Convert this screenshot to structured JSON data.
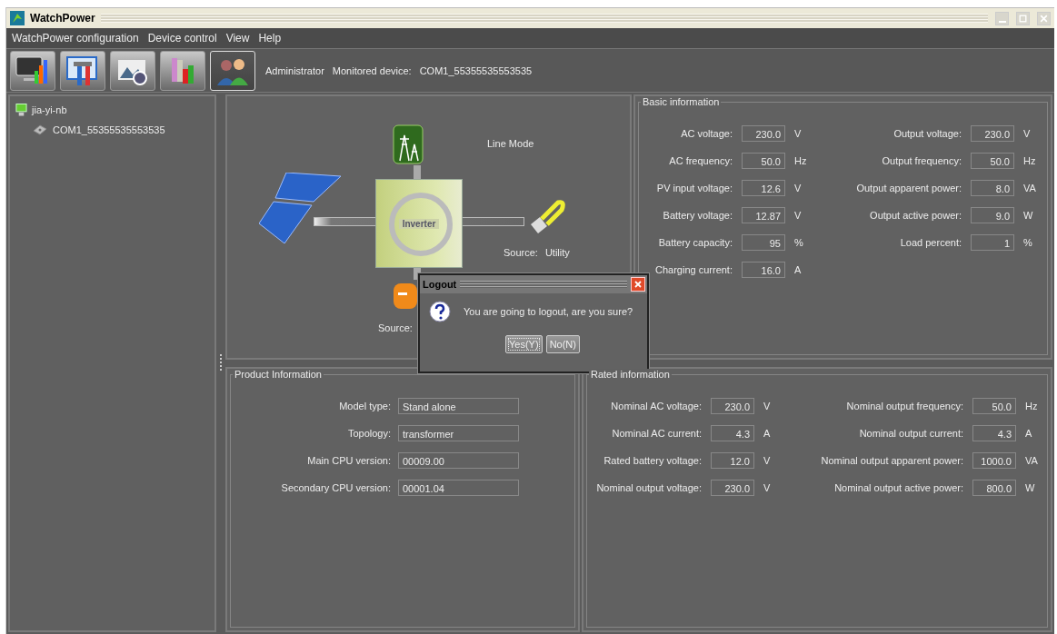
{
  "window": {
    "title": "WatchPower"
  },
  "menu": [
    "WatchPower configuration",
    "Device control",
    "View",
    "Help"
  ],
  "toolbar": {
    "buttons": [
      {
        "kind": "monitor",
        "selected": false
      },
      {
        "kind": "tools",
        "selected": false
      },
      {
        "kind": "photo",
        "selected": false
      },
      {
        "kind": "chart",
        "selected": false
      },
      {
        "kind": "users",
        "selected": true
      }
    ],
    "user": "Administrator",
    "device_label": "Monitored device:",
    "device": "COM1_55355535553535"
  },
  "tree": [
    {
      "label": "jia-yi-nb",
      "kind": "computer",
      "children": [
        {
          "label": "COM1_55355535553535",
          "kind": "port"
        }
      ]
    }
  ],
  "diagram": {
    "mode": "Line Mode",
    "inverter": "Inverter",
    "output_source": {
      "label": "Source:",
      "value": "Utility"
    },
    "battery_source": {
      "label": "Source:"
    }
  },
  "basic_info": {
    "title": "Basic information",
    "rows": [
      {
        "left": {
          "label": "AC voltage:",
          "value": "230.0",
          "unit": "V"
        },
        "right": {
          "label": "Output voltage:",
          "value": "230.0",
          "unit": "V"
        }
      },
      {
        "left": {
          "label": "AC frequency:",
          "value": "50.0",
          "unit": "Hz"
        },
        "right": {
          "label": "Output frequency:",
          "value": "50.0",
          "unit": "Hz"
        }
      },
      {
        "left": {
          "label": "PV input voltage:",
          "value": "12.6",
          "unit": "V"
        },
        "right": {
          "label": "Output apparent power:",
          "value": "8.0",
          "unit": "VA"
        }
      },
      {
        "left": {
          "label": "Battery voltage:",
          "value": "12.87",
          "unit": "V"
        },
        "right": {
          "label": "Output active power:",
          "value": "9.0",
          "unit": "W"
        }
      },
      {
        "left": {
          "label": "Battery capacity:",
          "value": "95",
          "unit": "%"
        },
        "right": {
          "label": "Load percent:",
          "value": "1",
          "unit": "%"
        }
      },
      {
        "left": {
          "label": "Charging current:",
          "value": "16.0",
          "unit": "A"
        }
      }
    ]
  },
  "product_info": {
    "title": "Product Information",
    "rows": [
      {
        "label": "Model type:",
        "value": "Stand alone"
      },
      {
        "label": "Topology:",
        "value": "transformer"
      },
      {
        "label": "Main CPU version:",
        "value": "00009.00"
      },
      {
        "label": "Secondary CPU version:",
        "value": "00001.04"
      }
    ]
  },
  "rated_info": {
    "title": "Rated information",
    "rows": [
      {
        "left": {
          "label": "Nominal AC voltage:",
          "value": "230.0",
          "unit": "V"
        },
        "right": {
          "label": "Nominal output frequency:",
          "value": "50.0",
          "unit": "Hz"
        }
      },
      {
        "left": {
          "label": "Nominal AC current:",
          "value": "4.3",
          "unit": "A"
        },
        "right": {
          "label": "Nominal output current:",
          "value": "4.3",
          "unit": "A"
        }
      },
      {
        "left": {
          "label": "Rated battery voltage:",
          "value": "12.0",
          "unit": "V"
        },
        "right": {
          "label": "Nominal output apparent power:",
          "value": "1000.0",
          "unit": "VA"
        }
      },
      {
        "left": {
          "label": "Nominal output voltage:",
          "value": "230.0",
          "unit": "V"
        },
        "right": {
          "label": "Nominal output active power:",
          "value": "800.0",
          "unit": "W"
        }
      }
    ]
  },
  "dialog": {
    "title": "Logout",
    "message": "You are going to logout, are you sure?",
    "buttons": [
      {
        "label": "Yes(Y)",
        "focused": true
      },
      {
        "label": "No(N)",
        "focused": false
      }
    ]
  }
}
